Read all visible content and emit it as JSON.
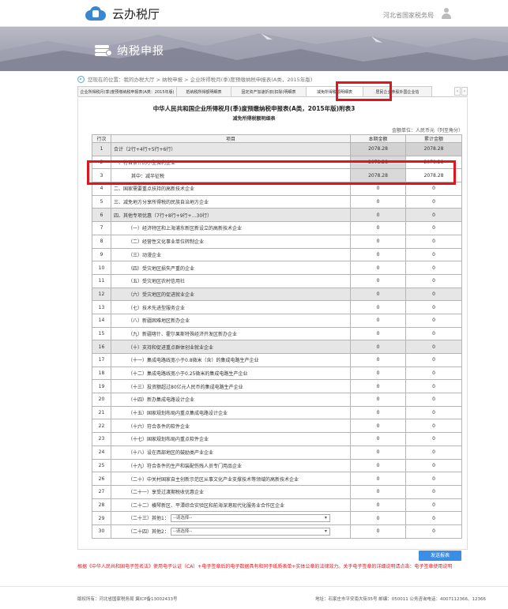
{
  "header": {
    "logo_text": "云办税厅",
    "org_name": "河北省国家税务局"
  },
  "banner": {
    "title": "纳税申报"
  },
  "breadcrumb": "您现在的位置：我的办税大厅 > 纳税申报 > 企业所得税月(季)度预缴纳税申报表(A类，2015年版)",
  "tabs": [
    "企业所得税月(季)度预缴纳税申报表(A类：2015年版)",
    "抵纳税所得额明细表",
    "固定资产加速折旧(扣除)明细表",
    "减免所得税额明细表",
    "居民企业参股外国企业信"
  ],
  "form": {
    "title": "中华人民共和国企业所得税月(季)度预缴纳税申报表(A类，2015年版)附表3",
    "subtitle": "减免所得税额明细表",
    "unit": "金额单位：人民币元（列至角分）",
    "col_no": "行次",
    "col_item": "项目",
    "col_current": "本期金额",
    "col_total": "累计金额"
  },
  "rows": [
    {
      "no": "1",
      "item": "合计（2行+4行+5行+6行）",
      "current": "2078.28",
      "total": "2078.28"
    },
    {
      "no": "2",
      "item": "一、符合条件的小型微利企业",
      "current": "2078.28",
      "total": "2078.28"
    },
    {
      "no": "3",
      "item": "其中：减半征税",
      "current": "2078.28",
      "total": "2078.28"
    },
    {
      "no": "4",
      "item": "二、国家需要重点扶持的高新技术企业",
      "current": "0",
      "total": "0"
    },
    {
      "no": "5",
      "item": "三、减免地方分享所得税的民族自治地方企业",
      "current": "0",
      "total": "0"
    },
    {
      "no": "6",
      "item": "四、其他专项优惠（7行+8行+9行+…30行）",
      "current": "0",
      "total": "0"
    },
    {
      "no": "7",
      "item": "（一）经济特区和上海浦东新区新设立的高新技术企业",
      "current": "0",
      "total": "0"
    },
    {
      "no": "8",
      "item": "（二）经营性文化事业单位转制企业",
      "current": "0",
      "total": "0"
    },
    {
      "no": "9",
      "item": "（三）动漫企业",
      "current": "0",
      "total": "0"
    },
    {
      "no": "10",
      "item": "（四）受灾地区损失严重的企业",
      "current": "0",
      "total": "0"
    },
    {
      "no": "11",
      "item": "（五）受灾地区农村信用社",
      "current": "0",
      "total": "0"
    },
    {
      "no": "12",
      "item": "（六）受灾地区的促进就业企业",
      "current": "0",
      "total": "0"
    },
    {
      "no": "13",
      "item": "（七）技术先进型服务企业",
      "current": "0",
      "total": "0"
    },
    {
      "no": "14",
      "item": "（八）新疆困难地区新办企业",
      "current": "0",
      "total": "0"
    },
    {
      "no": "15",
      "item": "（九）新疆喀什、霍尔果斯特殊经济开发区新办企业",
      "current": "0",
      "total": "0"
    },
    {
      "no": "16",
      "item": "（十）支持和促进重点群体创业就业企业",
      "current": "0",
      "total": "0"
    },
    {
      "no": "17",
      "item": "（十一）集成电路线宽小于0.8微米（含）的集成电路生产企业",
      "current": "0",
      "total": "0"
    },
    {
      "no": "18",
      "item": "（十二）集成电路线宽小于0.25微米的集成电路生产企业",
      "current": "0",
      "total": "0"
    },
    {
      "no": "19",
      "item": "（十三）投资额超过80亿元人民币的集成电路生产企业",
      "current": "0",
      "total": "0"
    },
    {
      "no": "20",
      "item": "（十四）新办集成电路设计企业",
      "current": "0",
      "total": "0"
    },
    {
      "no": "21",
      "item": "（十五）国家规划布局内重点集成电路设计企业",
      "current": "0",
      "total": "0"
    },
    {
      "no": "22",
      "item": "（十六）符合条件的软件企业",
      "current": "0",
      "total": "0"
    },
    {
      "no": "23",
      "item": "（十七）国家规划布局内重点软件企业",
      "current": "0",
      "total": "0"
    },
    {
      "no": "24",
      "item": "（十八）设在西部地区的鼓励类产业企业",
      "current": "0",
      "total": "0"
    },
    {
      "no": "25",
      "item": "（十九）符合条件的生产和装配伤残人员专门用品企业",
      "current": "0",
      "total": "0"
    },
    {
      "no": "26",
      "item": "（二十）中关村国家自主创新示范区从事文化产业支撑技术等领域的高新技术企业",
      "current": "0",
      "total": "0"
    },
    {
      "no": "27",
      "item": "（二十一）享受过渡期税收优惠企业",
      "current": "0",
      "total": "0"
    },
    {
      "no": "28",
      "item": "（二十二）横琴新区、平潭综合实验区和前海深港现代化服务业合作区企业",
      "current": "0",
      "total": "0"
    },
    {
      "no": "29",
      "item": "（二十三）其他1：",
      "select": "--请选择--",
      "current": "0",
      "total": "0"
    },
    {
      "no": "30",
      "item": "（二十四）其他2：",
      "select": "--请选择--",
      "current": "0",
      "total": "0"
    }
  ],
  "send_button": "发送报表",
  "notice": "根据《中华人民共和国电子签名法》使用电子认证（CA）+电子签章后的电子数据具有和同于纸质表单+实体公章的法律效力。关于电子签章的详细说明请点击：电子签章使用说明",
  "footer": {
    "copyright": "版权所有：河北省国家税务局 冀ICP备13002433号",
    "address": "地址：石家庄市平安南大街35号 邮编：050011 公务咨询电话：4007112366、12366"
  }
}
